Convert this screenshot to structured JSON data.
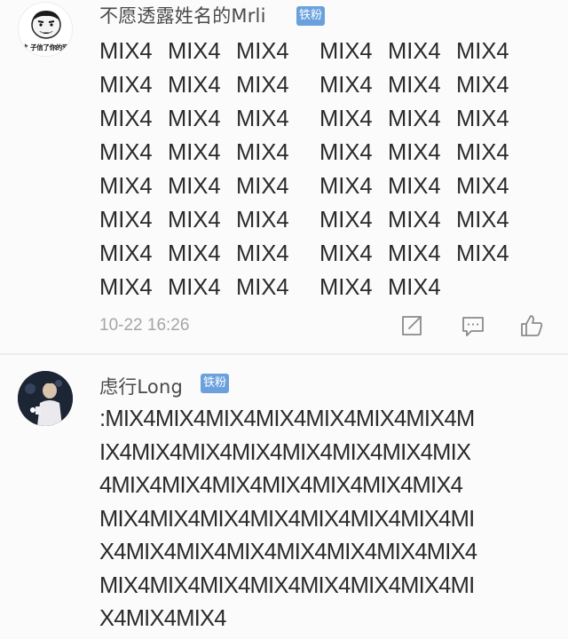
{
  "comment1": {
    "username": "不愿透露姓名的Mrli",
    "badge": "铁粉",
    "avatar_caption": "饣子信了你的邪",
    "lines": [
      [
        "MIX4",
        "MIX4",
        "MIX4",
        "MIX4",
        "MIX4",
        "MIX4"
      ],
      [
        "MIX4",
        "MIX4",
        "MIX4",
        "MIX4",
        "MIX4",
        "MIX4"
      ],
      [
        "MIX4",
        "MIX4",
        "MIX4",
        "MIX4",
        "MIX4",
        "MIX4"
      ],
      [
        "MIX4",
        "MIX4",
        "MIX4",
        "MIX4",
        "MIX4",
        "MIX4"
      ],
      [
        "MIX4",
        "MIX4",
        "MIX4",
        "MIX4",
        "MIX4",
        "MIX4"
      ],
      [
        "MIX4",
        "MIX4",
        "MIX4",
        "MIX4",
        "MIX4",
        "MIX4"
      ],
      [
        "MIX4",
        "MIX4",
        "MIX4",
        "MIX4",
        "MIX4",
        "MIX4"
      ],
      [
        "MIX4",
        "MIX4",
        "MIX4",
        "MIX4",
        "MIX4"
      ]
    ],
    "timestamp": "10-22 16:26",
    "actions": {
      "share_icon": "share-icon",
      "reply_icon": "comment-icon",
      "like_icon": "thumbs-up-icon"
    }
  },
  "comment2": {
    "username": "虑行Long",
    "badge": "铁粉",
    "lines": [
      ":MIX4MIX4MIX4MIX4MIX4MIX4MIX4M",
      "IX4MIX4MIX4MIX4MIX4MIX4MIX4MIX",
      "4MIX4MIX4MIX4MIX4MIX4MIX4MIX4",
      "MIX4MIX4MIX4MIX4MIX4MIX4MIX4MI",
      "X4MIX4MIX4MIX4MIX4MIX4MIX4MIX4",
      "MIX4MIX4MIX4MIX4MIX4MIX4MIX4MI",
      "X4MIX4MIX4"
    ]
  },
  "colors": {
    "background": "#fbfbfb",
    "text": "#2a2a2a",
    "username": "#4a4a4a",
    "badge": "#6aa1dd",
    "timestamp": "#a5a5a5",
    "divider": "#ececec"
  }
}
